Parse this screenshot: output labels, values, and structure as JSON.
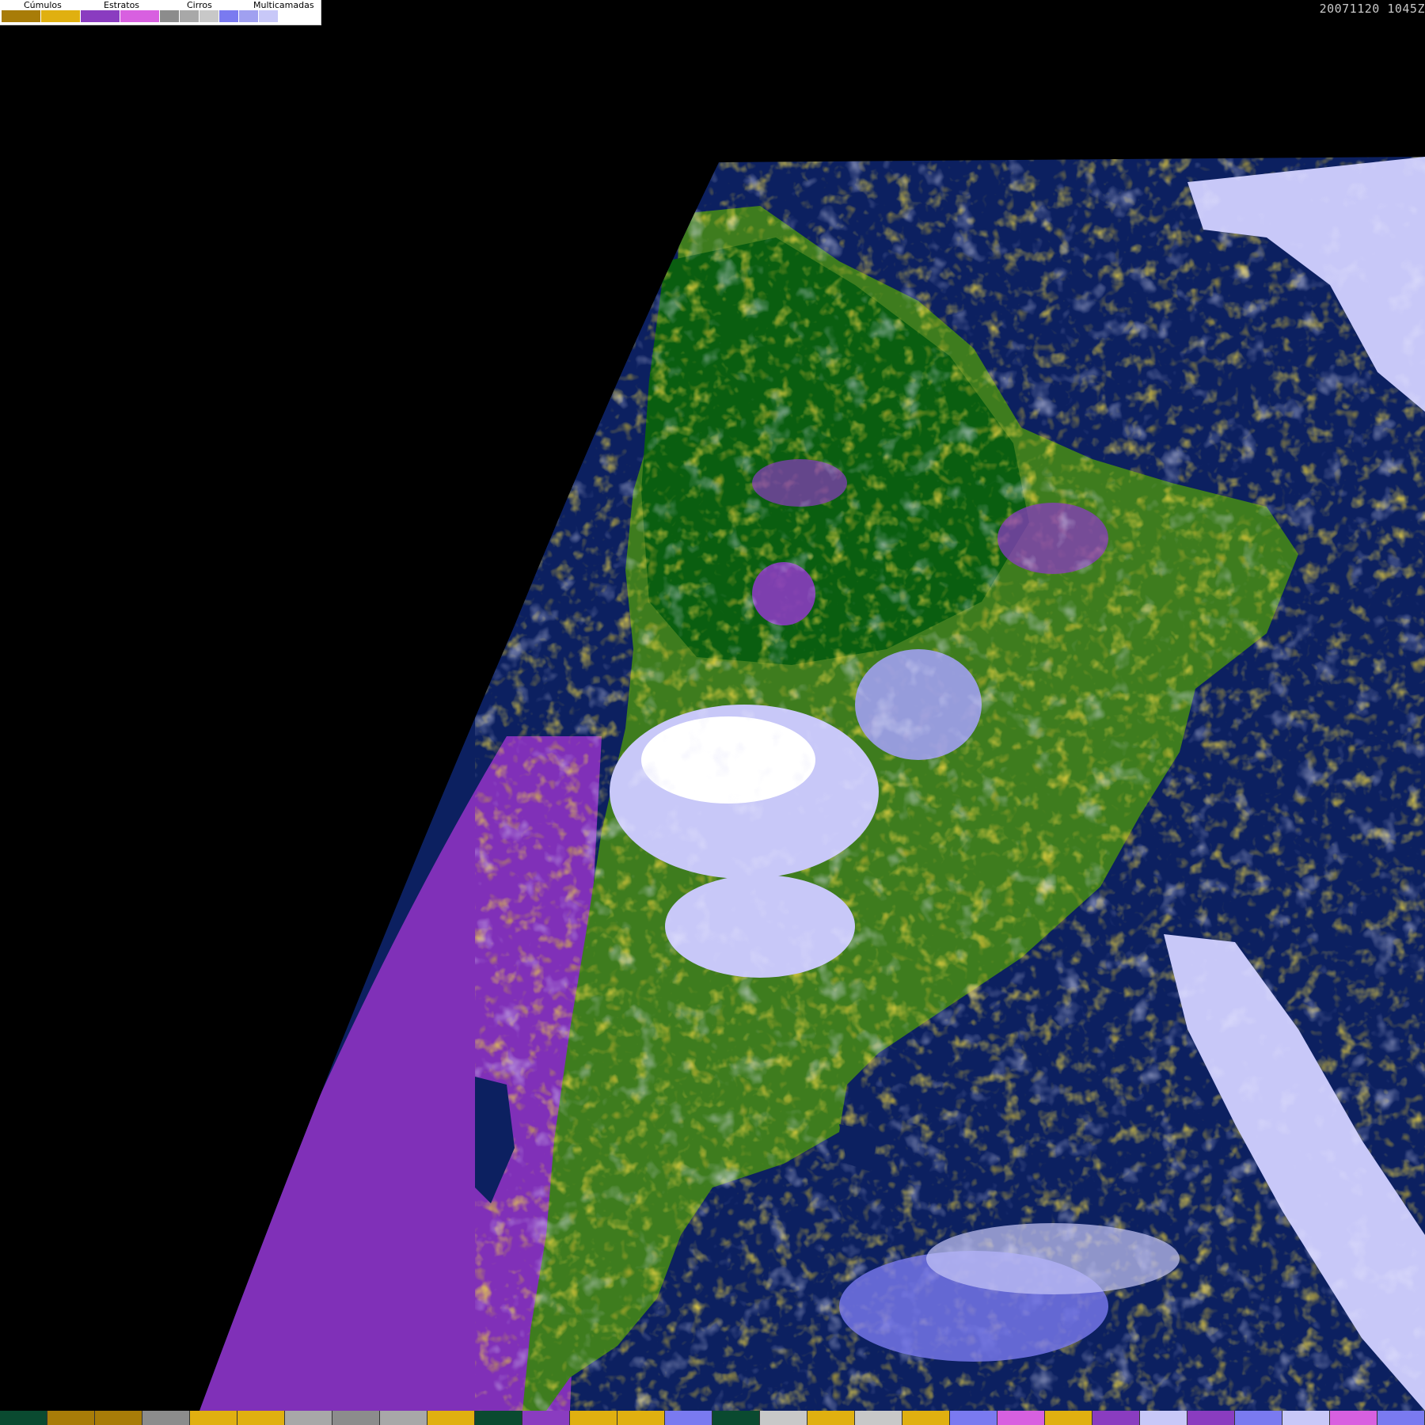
{
  "legend": {
    "groups": [
      {
        "label": "Cúmulos"
      },
      {
        "label": "Estratos"
      },
      {
        "label": "Cirros"
      },
      {
        "label": "Multicamadas"
      }
    ],
    "swatches": [
      "#a87c08",
      "#e0b010",
      "#8a3cc0",
      "#d860e0",
      "#8c8c8c",
      "#a8a8a8",
      "#c8c8c8",
      "#7a7af0",
      "#a0a0f0",
      "#c8c8f8",
      "#ffffff"
    ]
  },
  "timestamp": "20071120 1045Z",
  "colors": {
    "background": "#000000",
    "ocean": "#0c2060",
    "land": "#3a7a1c",
    "forest": "#0c6010",
    "cumulus_low": "#a87c08",
    "cumulus_high": "#e0b010",
    "stratus": "#8a3cc0",
    "stratus_light": "#d860e0",
    "cirrus": "#a8a8a8",
    "multilayer": "#c8c8f8"
  },
  "bottom_strip": [
    "#0a4a30",
    "#a87c08",
    "#a87c08",
    "#8c8c8c",
    "#e0b010",
    "#e0b010",
    "#a8a8a8",
    "#8c8c8c",
    "#a8a8a8",
    "#e0b010",
    "#0a4a30",
    "#8a3cc0",
    "#e0b010",
    "#e0b010",
    "#7a7af0",
    "#0a4a30",
    "#c8c8c8",
    "#e0b010",
    "#c8c8c8",
    "#e0b010",
    "#7a7af0",
    "#d860e0",
    "#e0b010",
    "#8a3cc0",
    "#c8c8f8",
    "#8a3cc0",
    "#7a7af0",
    "#c8c8f8",
    "#d860e0",
    "#7a7af0"
  ]
}
